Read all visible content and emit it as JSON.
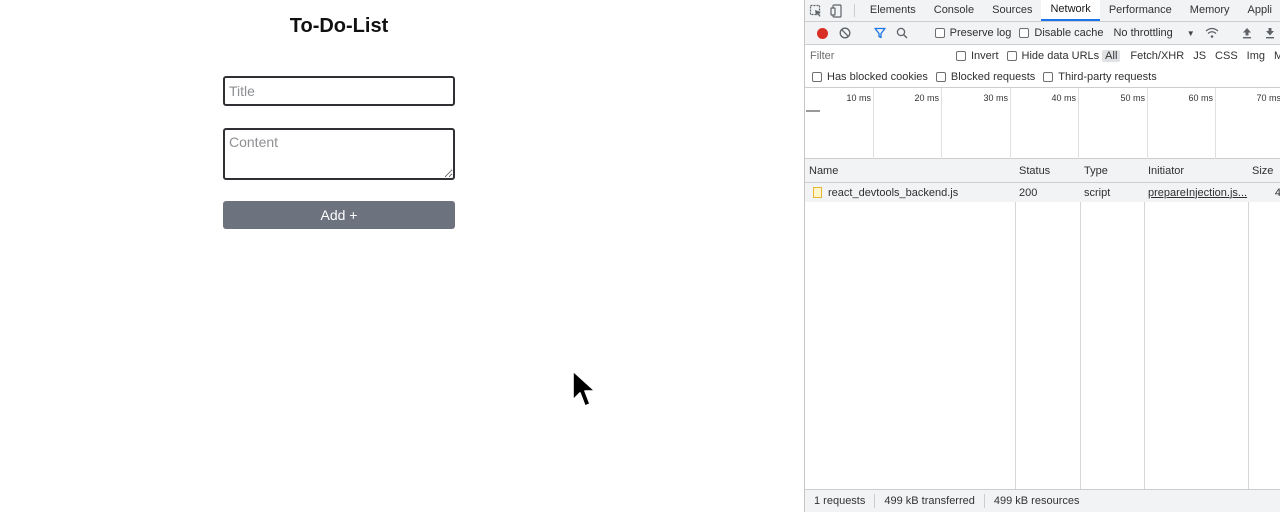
{
  "app": {
    "title": "To-Do-List",
    "title_placeholder": "Title",
    "content_placeholder": "Content",
    "add_label": "Add +"
  },
  "devtools": {
    "tabs": [
      "Elements",
      "Console",
      "Sources",
      "Network",
      "Performance",
      "Memory",
      "Appli"
    ],
    "active_tab": "Network",
    "toolbar": {
      "preserve_log": "Preserve log",
      "disable_cache": "Disable cache",
      "throttling": "No throttling"
    },
    "filter": {
      "placeholder": "Filter",
      "invert": "Invert",
      "hide_data_urls": "Hide data URLs",
      "types": [
        "All",
        "Fetch/XHR",
        "JS",
        "CSS",
        "Img",
        "M"
      ],
      "active_type": "All",
      "has_blocked_cookies": "Has blocked cookies",
      "blocked_requests": "Blocked requests",
      "third_party": "Third-party requests"
    },
    "timeline_labels": [
      "10 ms",
      "20 ms",
      "30 ms",
      "40 ms",
      "50 ms",
      "60 ms",
      "70 ms"
    ],
    "columns": [
      "Name",
      "Status",
      "Type",
      "Initiator",
      "Size"
    ],
    "rows": [
      {
        "name": "react_devtools_backend.js",
        "status": "200",
        "type": "script",
        "initiator": "prepareInjection.js...",
        "size": "4"
      }
    ],
    "status_bar": {
      "requests": "1 requests",
      "transferred": "499 kB transferred",
      "resources": "499 kB resources"
    },
    "colors": {
      "record": "#d93025",
      "active_tab_underline": "#1a73e8",
      "add_button": "#6c727e"
    }
  }
}
